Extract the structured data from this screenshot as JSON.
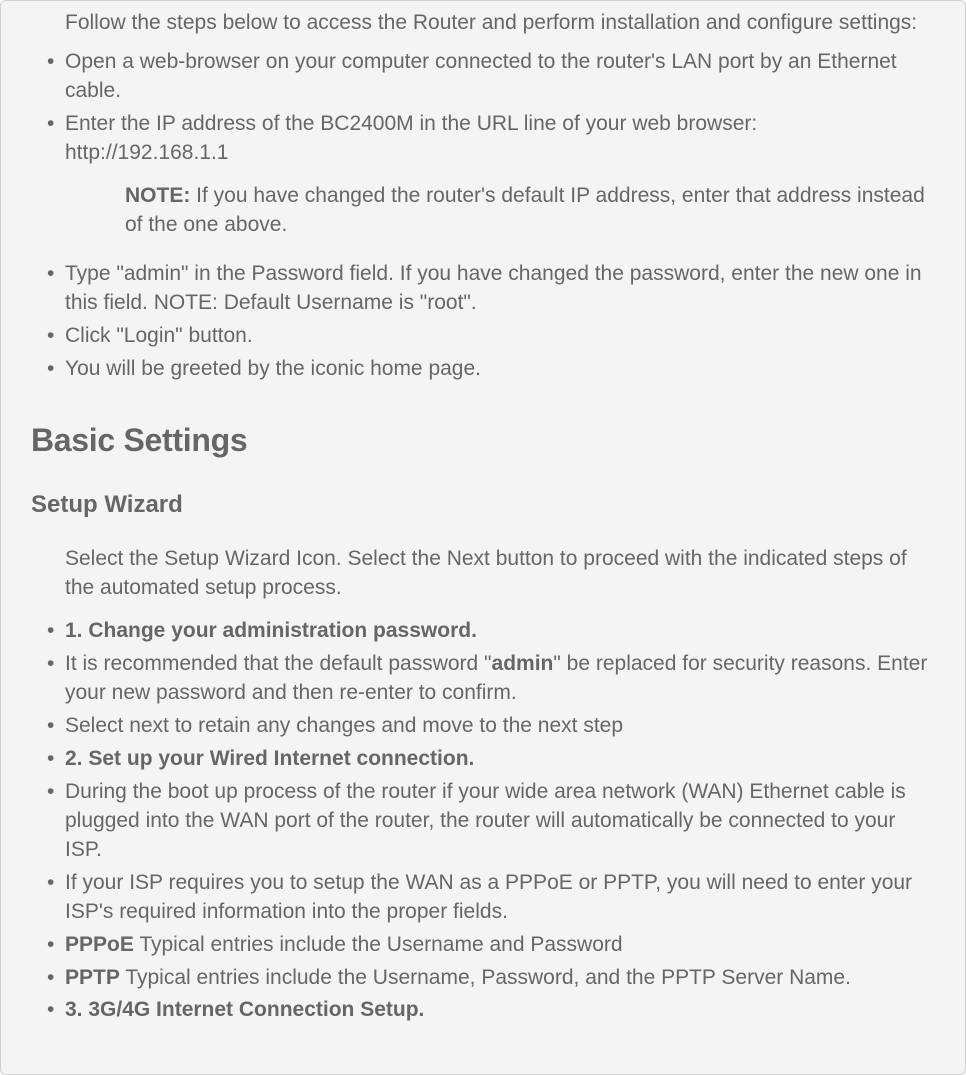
{
  "intro": "Follow the steps below to access the Router and perform installation and configure settings:",
  "steps1": {
    "a": "Open a web-browser on your computer connected to the router's LAN port by an Ethernet cable.",
    "b": "Enter the IP address of the BC2400M in the URL line of your web browser:",
    "b_url": "http://192.168.1.1",
    "note_label": "NOTE:",
    "note_text": " If you have changed the router's default IP address, enter that address instead of the one above.",
    "c": "Type \"admin\" in the Password field. If you have changed the password, enter the new one in this field. NOTE: Default Username is \"root\".",
    "d": "Click \"Login\" button.",
    "e": "You will be greeted by the iconic home page."
  },
  "section_title": "Basic Settings",
  "subsection_title": "Setup Wizard",
  "wizard_intro": "Select the Setup Wizard Icon. Select the Next button to proceed with the indicated steps of the automated setup process.",
  "wizard": {
    "i1": "1. Change your administration password.",
    "i2a": "It is recommended that the default password \"",
    "i2b": "admin",
    "i2c": "\" be replaced for security reasons. Enter your new password and then re-enter to confirm.",
    "i3": "Select next to retain any changes and move to the next step",
    "i4": "2. Set up your Wired Internet connection.",
    "i5": "During the boot up process of the router if your wide area network (WAN) Ethernet cable is plugged into the WAN port of the router, the router will automatically be connected to your ISP.",
    "i6": "If your ISP requires you to setup the WAN as a PPPoE or PPTP, you will need to enter your ISP's required information into the proper fields.",
    "i7a": "PPPoE",
    "i7b": " Typical entries include the Username and Password",
    "i8a": "PPTP",
    "i8b": " Typical entries include the Username, Password, and the PPTP Server Name.",
    "i9": "3. 3G/4G Internet Connection Setup."
  }
}
